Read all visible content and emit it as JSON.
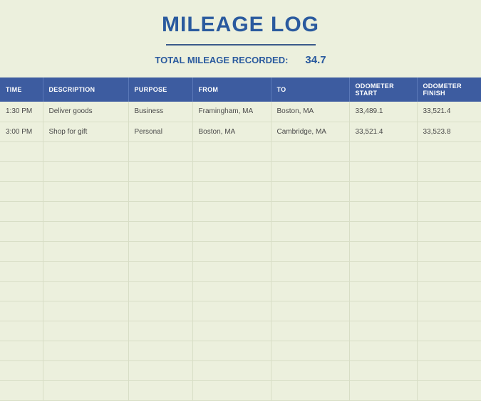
{
  "header": {
    "title": "MILEAGE LOG",
    "total_label": "TOTAL MILEAGE RECORDED:",
    "total_value": "34.7"
  },
  "table": {
    "headers": {
      "time": "TIME",
      "description": "DESCRIPTION",
      "purpose": "PURPOSE",
      "from": "FROM",
      "to": "TO",
      "odo_start": "ODOMETER START",
      "odo_finish": "ODOMETER FINISH"
    },
    "rows": [
      {
        "time": "1:30 PM",
        "description": "Deliver goods",
        "purpose": "Business",
        "from": "Framingham, MA",
        "to": "Boston, MA",
        "odo_start": "33,489.1",
        "odo_finish": "33,521.4"
      },
      {
        "time": "3:00 PM",
        "description": "Shop for gift",
        "purpose": "Personal",
        "from": "Boston, MA",
        "to": "Cambridge, MA",
        "odo_start": "33,521.4",
        "odo_finish": "33,523.8"
      }
    ],
    "empty_row_count": 13
  }
}
